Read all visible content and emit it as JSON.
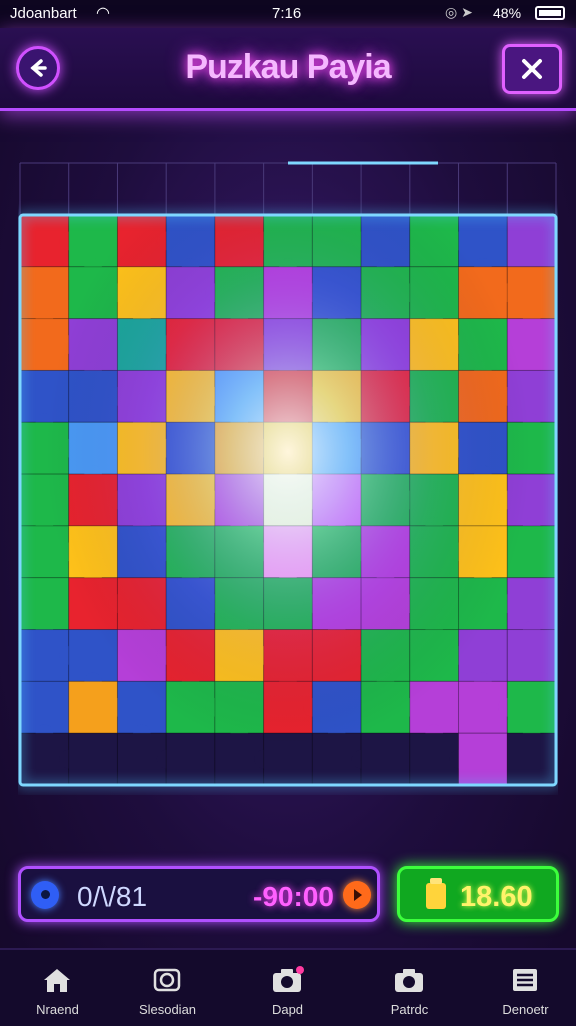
{
  "status_bar": {
    "carrier": "Jdoanbart",
    "time": "7:16",
    "battery": "48%"
  },
  "header": {
    "title": "Puzkau Payia"
  },
  "puzzle": {
    "pieces": [
      [
        "#e8232e",
        "#1eb84a",
        "#e8232e",
        "#2f53c8",
        "#e8232e",
        "#1eb84a",
        "#1eb84a",
        "#2f53c8",
        "#1eb84a",
        "#2f53c8",
        "#8f3fd6"
      ],
      [
        "#f26a1c",
        "#1eb84a",
        "#ffc21a",
        "#8f3fd6",
        "#1eb84a",
        "#b53fd8",
        "#2f53c8",
        "#1eb84a",
        "#1eb84a",
        "#f26a1c",
        "#f26a1c"
      ],
      [
        "#f26a1c",
        "#8f3fd6",
        "#1aa89a",
        "#e8232e",
        "#e8232e",
        "#8f3fd6",
        "#1eb84a",
        "#8f3fd6",
        "#ffc21a",
        "#1eb84a",
        "#b53fd8"
      ],
      [
        "#2f53c8",
        "#2f53c8",
        "#8f3fd6",
        "#ffc21a",
        "#4a9af5",
        "#e8232e",
        "#ffc21a",
        "#e8232e",
        "#1eb84a",
        "#f26a1c",
        "#8f3fd6"
      ],
      [
        "#1eb84a",
        "#4a9af5",
        "#ffc21a",
        "#2f53c8",
        "#f5a01c",
        "#ffc21a",
        "#4a9af5",
        "#2f53c8",
        "#ffc21a",
        "#2f53c8",
        "#1eb84a"
      ],
      [
        "#1eb84a",
        "#e8232e",
        "#8f3fd6",
        "#ffc21a",
        "#b53fd8",
        "#fff2d0",
        "#d060f5",
        "#1eb84a",
        "#1eb84a",
        "#ffc21a",
        "#8f3fd6"
      ],
      [
        "#1eb84a",
        "#ffc21a",
        "#2f53c8",
        "#1eb84a",
        "#1eb84a",
        "#ffa0f0",
        "#1eb84a",
        "#b53fd8",
        "#1eb84a",
        "#ffc21a",
        "#1eb84a"
      ],
      [
        "#1eb84a",
        "#e8232e",
        "#e8232e",
        "#2f53c8",
        "#1eb84a",
        "#1eb84a",
        "#b53fd8",
        "#b53fd8",
        "#1eb84a",
        "#1eb84a",
        "#8f3fd6"
      ],
      [
        "#2f53c8",
        "#2f53c8",
        "#b53fd8",
        "#e8232e",
        "#ffc21a",
        "#e8232e",
        "#e8232e",
        "#1eb84a",
        "#1eb84a",
        "#8f3fd6",
        "#8f3fd6"
      ],
      [
        "#2f53c8",
        "#f5a01c",
        "#2f53c8",
        "#1eb84a",
        "#1eb84a",
        "#e8232e",
        "#2f53c8",
        "#1eb84a",
        "#b53fd8",
        "#b53fd8",
        "#1eb84a"
      ],
      [
        "#1d1545",
        "#1d1545",
        "#1d1545",
        "#1d1545",
        "#1d1545",
        "#1d1545",
        "#1d1545",
        "#1d1545",
        "#1d1545",
        "#b53fd8",
        "#1d1545"
      ]
    ]
  },
  "progress": {
    "counter": "0/\\/81",
    "timer": "-90:00"
  },
  "score": {
    "value": "18.60"
  },
  "nav": {
    "items": [
      {
        "label": "Nraend",
        "icon": "home-icon"
      },
      {
        "label": "Slesodian",
        "icon": "puzzle-icon"
      },
      {
        "label": "Dapd",
        "icon": "camera-icon"
      },
      {
        "label": "Patrdc",
        "icon": "camera-alt-icon"
      },
      {
        "label": "Denoetr",
        "icon": "document-icon"
      }
    ]
  }
}
